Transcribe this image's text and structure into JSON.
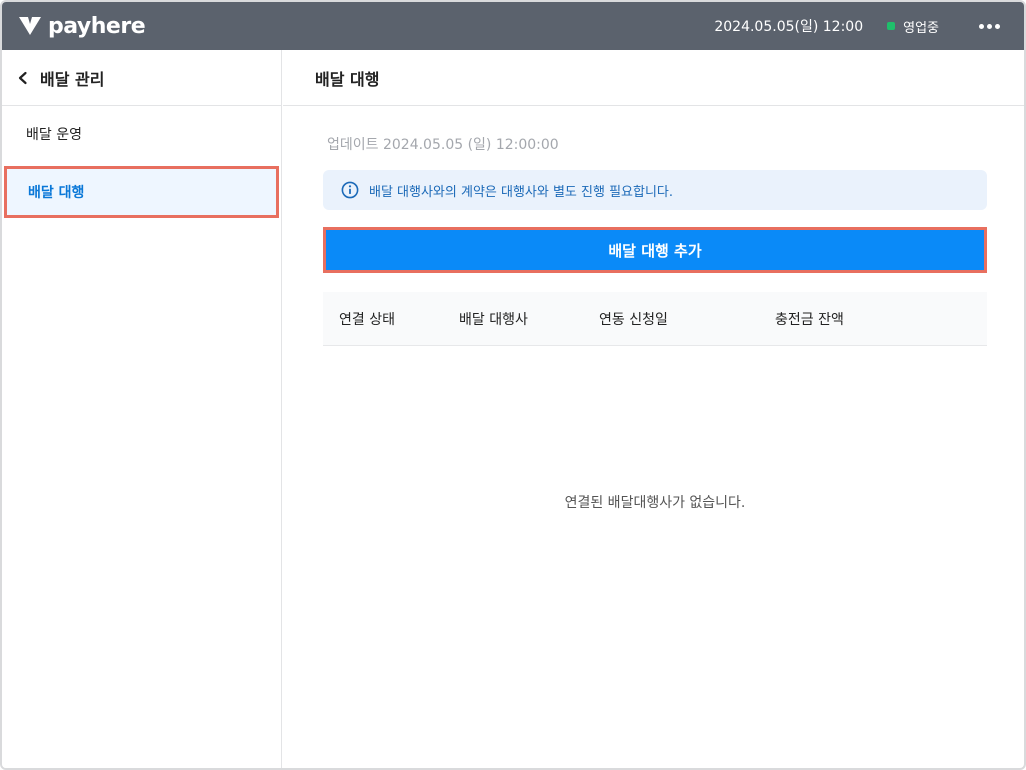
{
  "topbar": {
    "brand": "payhere",
    "datetime": "2024.05.05(일) 12:00",
    "status": "영업중",
    "status_color": "#1fbf6b",
    "more_icon": "more-horizontal-icon"
  },
  "sidebar": {
    "title": "배달 관리",
    "back_icon": "chevron-left-icon",
    "items": [
      {
        "label": "배달 운영",
        "active": false
      },
      {
        "label": "배달 대행",
        "active": true
      }
    ]
  },
  "main": {
    "title": "배달 대행",
    "update_text": "업데이트 2024.05.05 (일) 12:00:00",
    "notice": {
      "icon": "info-icon",
      "text": "배달 대행사와의 계약은 대행사와 별도 진행 필요합니다."
    },
    "add_button_label": "배달 대행 추가",
    "table": {
      "columns": [
        "연결 상태",
        "배달 대행사",
        "연동 신청일",
        "충전금 잔액"
      ]
    },
    "empty_text": "연결된 배달대행사가 없습니다."
  },
  "colors": {
    "topbar_bg": "#5b626d",
    "accent": "#0a8af8",
    "active_text": "#0a78d8",
    "highlight_border": "#e86f5f"
  }
}
